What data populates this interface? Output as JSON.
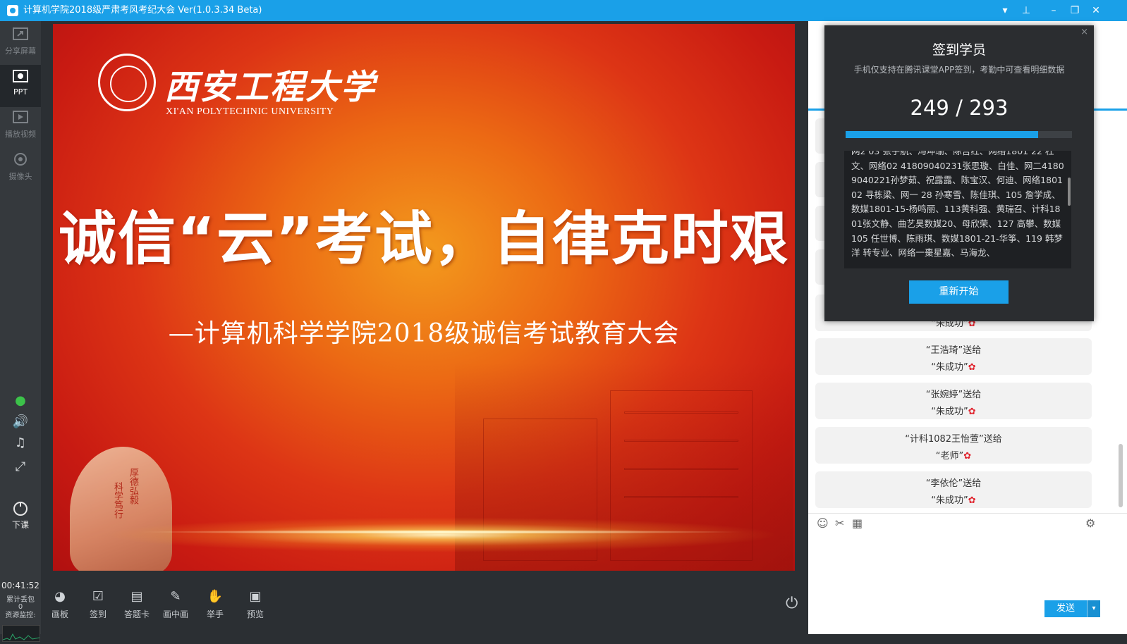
{
  "window": {
    "title": "计算机学院2018级严肃考风考纪大会 Ver(1.0.3.34 Beta)",
    "controls": [
      "▾",
      "⊥",
      "–",
      "❐",
      "✕"
    ]
  },
  "left_toolbar": {
    "items": [
      {
        "label": "分享屏幕",
        "icon": "share-screen-icon"
      },
      {
        "label": "PPT",
        "icon": "ppt-icon"
      },
      {
        "label": "播放视频",
        "icon": "play-video-icon"
      },
      {
        "label": "摄像头",
        "icon": "camera-icon"
      }
    ],
    "end_class_label": "下课",
    "timer": "00:41:52",
    "stats_label": "累计丢包",
    "stats_value": "0",
    "monitor_label": "资源监控:"
  },
  "slide": {
    "university_cn": "西安工程大学",
    "university_en": "XI'AN POLYTECHNIC UNIVERSITY",
    "headline": "诚信“云”考试，自律克时艰",
    "subtitle": "—计算机科学学院2018级诚信考试教育大会",
    "rock_text": [
      "厚德弘毅",
      "科学笃行"
    ]
  },
  "bottom_toolbar": {
    "items": [
      "画板",
      "签到",
      "答题卡",
      "画中画",
      "举手",
      "预览"
    ]
  },
  "signin_popup": {
    "title": "签到学员",
    "subtitle": "手机仅支持在腾讯课堂APP签到，考勤中可查看明细数据",
    "count_text": "249 / 293",
    "progress": 0.85,
    "names_text": "网2 03 张宇航、冯坤瑜、陈吉红、网络1801 22 杜文、网络02 41809040231张思璇、白佳、网二41809040221孙梦茹、祝露露、陈宝汉、何迪、网络1801 02 寻栋梁、网一 28 孙寒雪、陈佳琪、105 詹学成、数媒1801-15-杨鸣丽、113黄科强、黄瑞召、计科1801张文静、曲艺昊数媒20、母欣荣、127 高攀、数媒105 任世博、陈雨琪、数媒1801-21-华筝、119 韩梦洋 转专业、网络一棗星嘉、马海龙、",
    "restart_label": "重新开始",
    "close_label": "×"
  },
  "chat": {
    "messages": [
      {
        "line1": "",
        "line2": "“朱成功”"
      },
      {
        "line1": "“王浩琦”送给",
        "line2": "“朱成功”"
      },
      {
        "line1": "“张婉婷”送给",
        "line2": "“朱成功”"
      },
      {
        "line1": "“计科1082王怡萱”送给",
        "line2": "“老师”"
      },
      {
        "line1": "“李依伦”送给",
        "line2": "“朱成功”"
      }
    ],
    "send_label": "发送",
    "send_dropdown": "▾"
  },
  "colors": {
    "accent": "#1aa0e8",
    "titlebar": "#1aa0e8",
    "dark_bg": "#2b2f33",
    "slide_red": "#c81a12",
    "slide_orange": "#f39a1d"
  }
}
